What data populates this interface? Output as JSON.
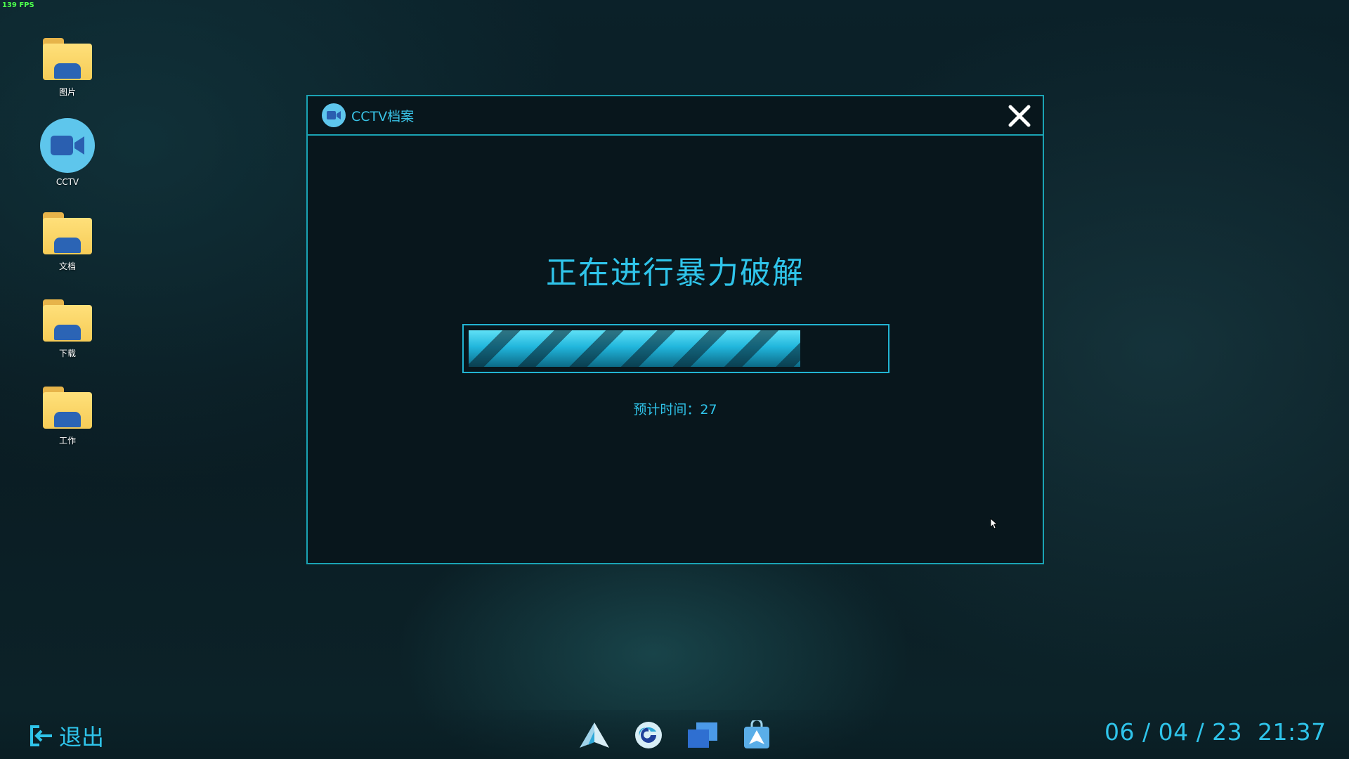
{
  "fps": "139 FPS",
  "desktop": {
    "icons": [
      {
        "label": "图片"
      },
      {
        "label": "CCTV"
      },
      {
        "label": "文档"
      },
      {
        "label": "下载"
      },
      {
        "label": "工作"
      }
    ]
  },
  "dialog": {
    "title": "CCTV档案",
    "headline": "正在进行暴力破解",
    "progress_fraction": 0.8,
    "eta_label": "预计时间：",
    "eta_value": "27"
  },
  "taskbar": {
    "logout_label": "退出",
    "apps": [
      "navigator-icon",
      "browser-icon",
      "windows-icon",
      "store-icon"
    ],
    "date": "06 / 04 / 23",
    "time": "21:37"
  },
  "colors": {
    "accent": "#2fc4ea",
    "border": "#1aa3b4",
    "folder": "#f6cc57",
    "cctv": "#5ec6ec"
  }
}
